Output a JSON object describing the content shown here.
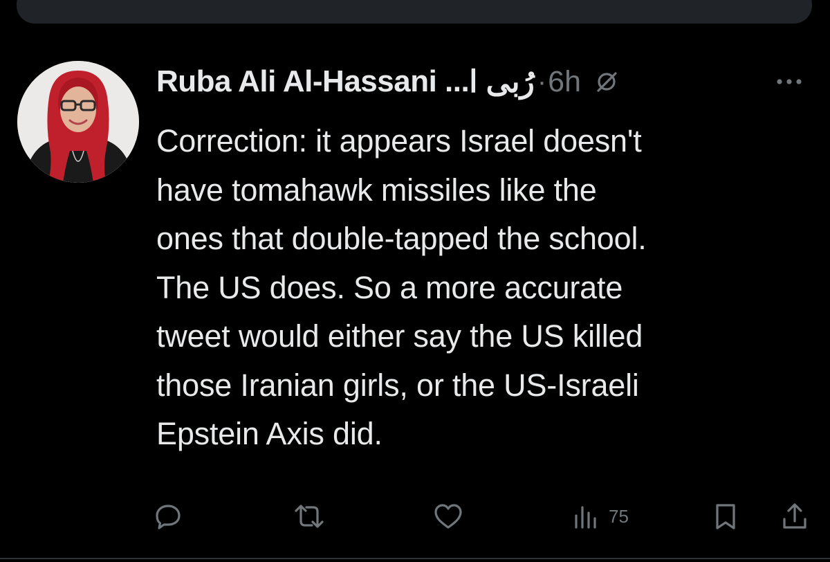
{
  "tweet": {
    "display_name": "Ruba Ali Al-Hassani ...",
    "arabic_name": "رُبى ا",
    "separator": "·",
    "timestamp": "6h",
    "text_lines": [
      "Correction: it appears Israel doesn't",
      "have tomahawk missiles like the",
      "ones that double-tapped the school.",
      "The US does. So a more accurate",
      "tweet would either say the US killed",
      "those Iranian girls, or the US-Israeli",
      "Epstein Axis did."
    ]
  },
  "actions": {
    "reply_icon": "reply-bubble-icon",
    "retweet_icon": "retweet-icon",
    "like_icon": "heart-icon",
    "views_icon": "views-bar-chart-icon",
    "views_count": "75",
    "bookmark_icon": "bookmark-icon",
    "share_icon": "share-upload-icon"
  },
  "colors": {
    "background": "#000000",
    "text_primary": "#e7e9ea",
    "text_secondary": "#71767b",
    "top_bar": "#202327",
    "hijab_red": "#c0202b"
  }
}
